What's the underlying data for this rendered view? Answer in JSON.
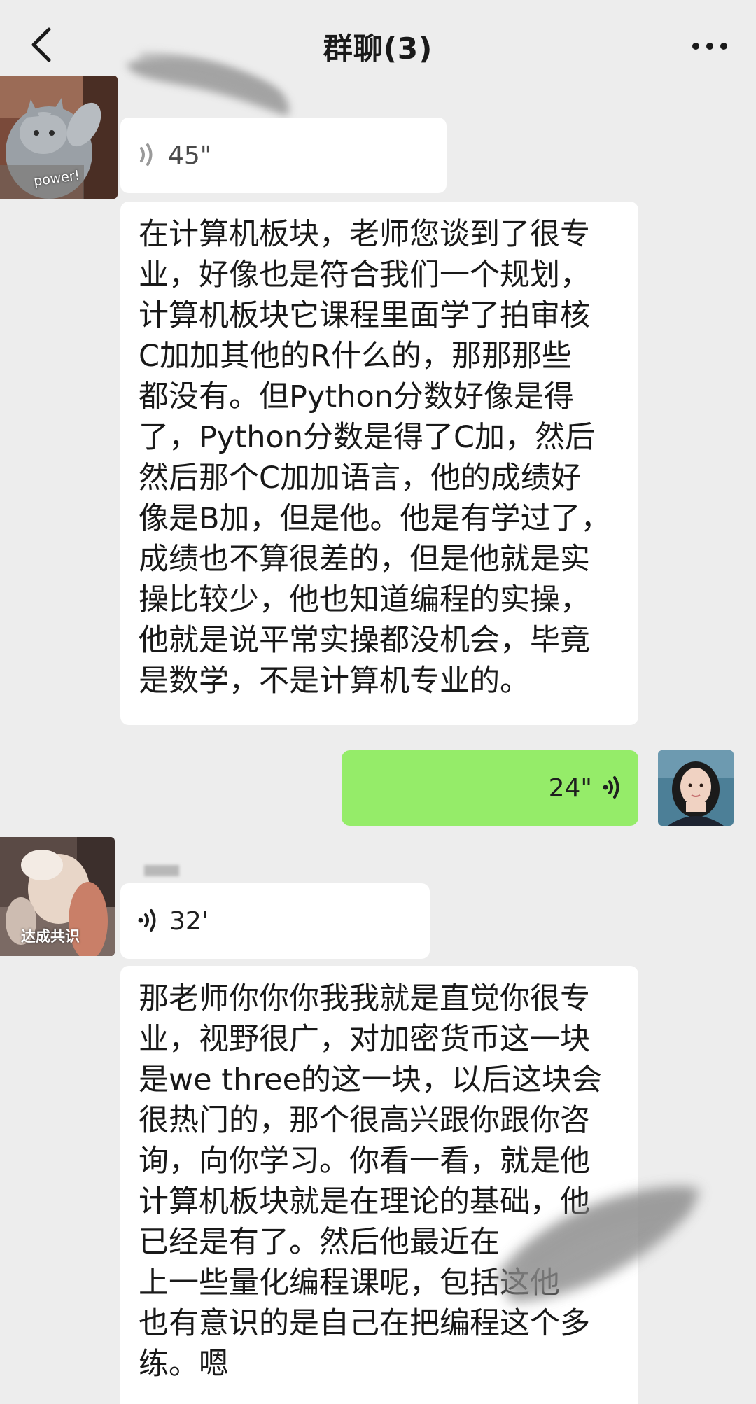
{
  "header": {
    "title": "群聊(3)",
    "back_icon": "chevron-left-icon",
    "more_icon": "more-dots-icon"
  },
  "messages": [
    {
      "side": "left",
      "avatar_caption": "power!",
      "voice_duration": "45\"",
      "text_lines": [
        "在计算机板块，老师您谈到了很专",
        "业，好像也是符合我们一个规划，",
        "计算机板块它课程里面学了拍审核",
        "C加加其他的R什么的，那那那些",
        "都没有。但Python分数好像是得",
        "了，Python分数是得了C加，然后",
        "然后那个C加加语言，他的成绩好",
        "像是B加，但是他。他是有学过了，",
        "成绩也不算很差的，但是他就是实",
        "操比较少，他也知道编程的实操，",
        "他就是说平常实操都没机会，毕竟",
        "是数学，不是计算机专业的。"
      ]
    },
    {
      "side": "right",
      "voice_duration": "24\""
    },
    {
      "side": "left",
      "avatar_caption": "达成共识",
      "voice_duration": "32'",
      "text_lines": [
        "那老师你你你我我就是直觉你很专",
        "业，视野很广，对加密货币这一块",
        "是we three的这一块，以后这块会",
        "很热门的，那个很高兴跟你跟你咨",
        "询，向你学习。你看一看，就是他",
        "计算机板块就是在理论的基础，他",
        "已经是有了。然后他最近在",
        "上一些量化编程课呢，包括这他",
        "也有意识的是自己在把编程这个多",
        "练。嗯"
      ]
    }
  ],
  "colors": {
    "background": "#ededed",
    "bubble_incoming": "#ffffff",
    "bubble_outgoing": "#95ec69",
    "text": "#191919"
  }
}
